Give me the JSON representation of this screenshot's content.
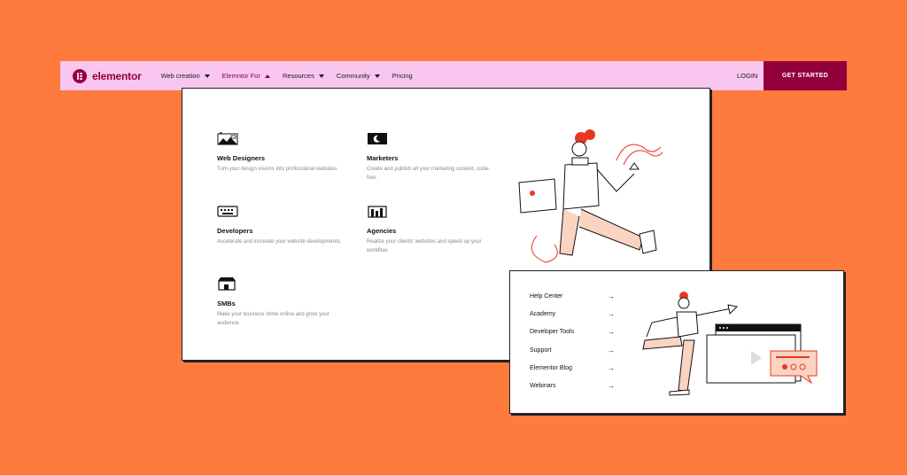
{
  "brand": {
    "name": "elementor",
    "color": "#92003B"
  },
  "colors": {
    "background": "#FF7A3D",
    "navbar": "#F9C6F0",
    "accent": "#E8371E"
  },
  "nav": {
    "items": [
      {
        "label": "Web creation",
        "caret": true
      },
      {
        "label": "Elemntor For",
        "caret": true,
        "active": true
      },
      {
        "label": "Resources",
        "caret": true
      },
      {
        "label": "Community",
        "caret": true
      },
      {
        "label": "Pricing",
        "caret": false
      }
    ],
    "login": "LOGIN",
    "cta": "GET STARTED"
  },
  "dropdown": {
    "cards": [
      {
        "title": "Web Designers",
        "desc": "Turn your design visions into professional websites.",
        "icon": "web-designers-icon"
      },
      {
        "title": "Marketers",
        "desc": "Create and publish all your marketing content, code-free.",
        "icon": "marketers-icon"
      },
      {
        "title": "Developers",
        "desc": "Accelerate and innovate your website developments.",
        "icon": "developers-icon"
      },
      {
        "title": "Agencies",
        "desc": "Realize your clients' websites and speed up your workflow.",
        "icon": "agencies-icon"
      },
      {
        "title": "SMBs",
        "desc": "Make your business shine online and grow your audience.",
        "icon": "smbs-icon"
      }
    ]
  },
  "resources": {
    "items": [
      {
        "label": "Help Center",
        "arrow": "→"
      },
      {
        "label": "Academy",
        "arrow": "→"
      },
      {
        "label": "Developer Tools",
        "arrow": "→"
      },
      {
        "label": "Support",
        "arrow": "→"
      },
      {
        "label": "Elementor Blog",
        "arrow": "→"
      },
      {
        "label": "Webinars",
        "arrow": "→"
      }
    ]
  }
}
